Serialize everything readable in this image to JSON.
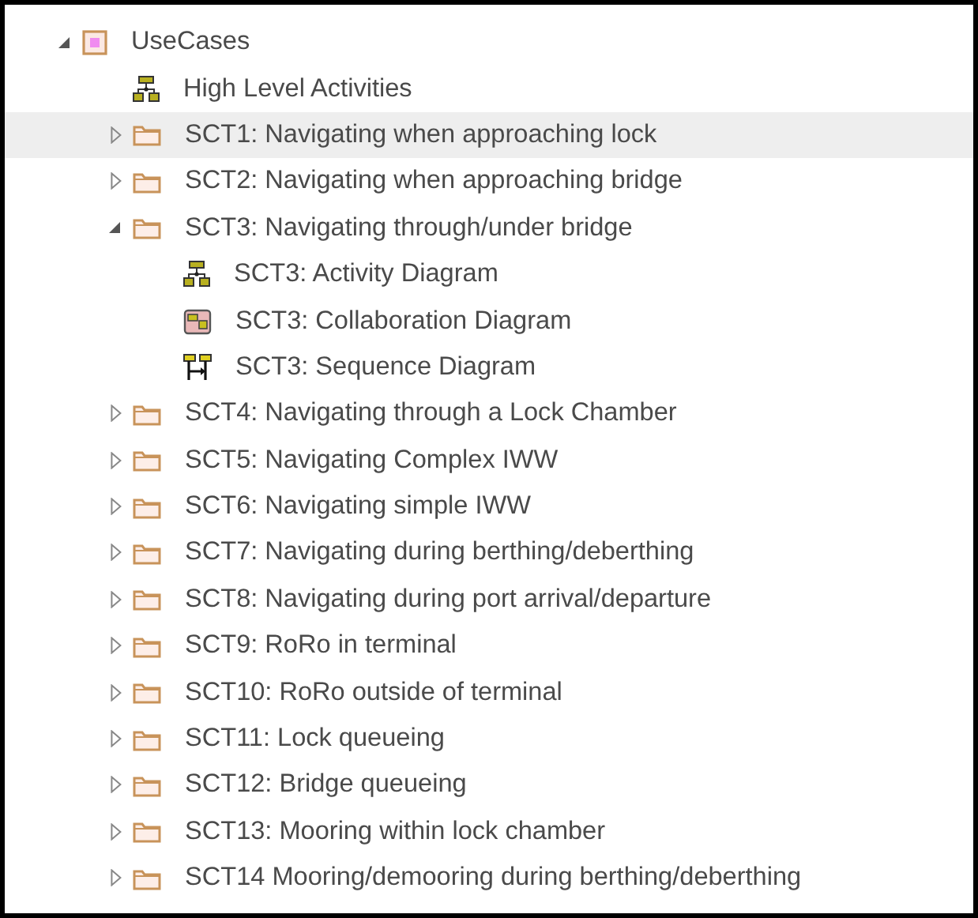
{
  "tree": [
    {
      "label": "UseCases",
      "kind": "package",
      "expanded": true,
      "selected": false,
      "children": [
        {
          "label": "High Level Activities",
          "kind": "activity",
          "selected": false
        },
        {
          "label": "SCT1: Navigating when approaching lock",
          "kind": "folder",
          "expanded": false,
          "selected": true
        },
        {
          "label": "SCT2: Navigating when approaching bridge",
          "kind": "folder",
          "expanded": false,
          "selected": false
        },
        {
          "label": "SCT3: Navigating through/under bridge",
          "kind": "folder",
          "expanded": true,
          "selected": false,
          "children": [
            {
              "label": "SCT3: Activity Diagram",
              "kind": "activity",
              "selected": false
            },
            {
              "label": "SCT3: Collaboration Diagram",
              "kind": "collaboration",
              "selected": false
            },
            {
              "label": "SCT3: Sequence Diagram",
              "kind": "sequence",
              "selected": false
            }
          ]
        },
        {
          "label": "SCT4: Navigating through a Lock Chamber",
          "kind": "folder",
          "expanded": false,
          "selected": false
        },
        {
          "label": "SCT5: Navigating Complex IWW",
          "kind": "folder",
          "expanded": false,
          "selected": false
        },
        {
          "label": "SCT6: Navigating simple IWW",
          "kind": "folder",
          "expanded": false,
          "selected": false
        },
        {
          "label": "SCT7: Navigating during berthing/deberthing",
          "kind": "folder",
          "expanded": false,
          "selected": false
        },
        {
          "label": "SCT8: Navigating during port arrival/departure",
          "kind": "folder",
          "expanded": false,
          "selected": false
        },
        {
          "label": "SCT9: RoRo in terminal",
          "kind": "folder",
          "expanded": false,
          "selected": false
        },
        {
          "label": "SCT10: RoRo outside of terminal",
          "kind": "folder",
          "expanded": false,
          "selected": false
        },
        {
          "label": "SCT11: Lock queueing",
          "kind": "folder",
          "expanded": false,
          "selected": false
        },
        {
          "label": "SCT12: Bridge queueing",
          "kind": "folder",
          "expanded": false,
          "selected": false
        },
        {
          "label": "SCT13: Mooring within lock chamber",
          "kind": "folder",
          "expanded": false,
          "selected": false
        },
        {
          "label": "SCT14 Mooring/demooring during berthing/deberthing",
          "kind": "folder",
          "expanded": false,
          "selected": false
        }
      ]
    }
  ]
}
